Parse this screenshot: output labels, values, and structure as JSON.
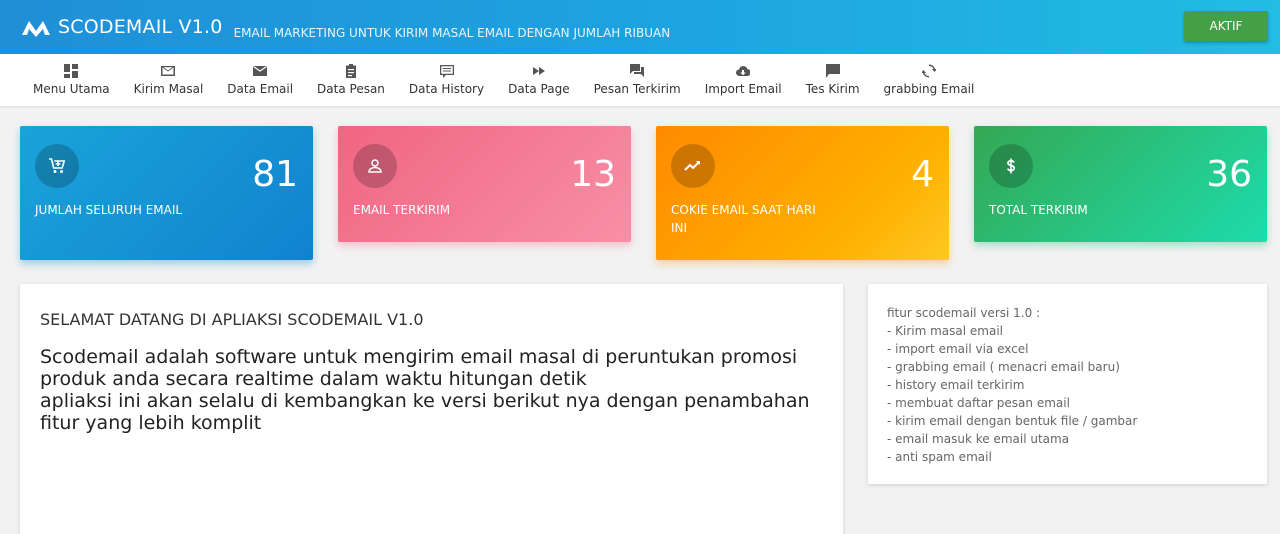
{
  "header": {
    "brand": "SCODEMAIL V1.0",
    "tagline": "EMAIL MARKETING UNTUK KIRIM MASAL EMAIL DENGAN JUMLAH RIBUAN",
    "status_button": "AKTIF",
    "colors": {
      "bar_start": "#1f8fd8",
      "bar_end": "#21bde3",
      "status": "#43a047"
    }
  },
  "nav": [
    {
      "label": "Menu Utama",
      "icon": "dashboard-icon"
    },
    {
      "label": "Kirim Masal",
      "icon": "envelope-outline-icon"
    },
    {
      "label": "Data Email",
      "icon": "envelope-icon"
    },
    {
      "label": "Data Pesan",
      "icon": "clipboard-icon"
    },
    {
      "label": "Data History",
      "icon": "message-list-icon"
    },
    {
      "label": "Data Page",
      "icon": "fast-forward-icon"
    },
    {
      "label": "Pesan Terkirim",
      "icon": "chat-icon"
    },
    {
      "label": "Import Email",
      "icon": "cloud-download-icon"
    },
    {
      "label": "Tes Kirim",
      "icon": "comment-icon"
    },
    {
      "label": "grabbing Email",
      "icon": "refresh-icon"
    }
  ],
  "stats": [
    {
      "value": "81",
      "label": "JUMLAH SELURUH EMAIL",
      "icon": "cart-add-icon",
      "color": "#1182cf"
    },
    {
      "value": "13",
      "label": "EMAIL TERKIRIM",
      "icon": "person-icon",
      "color": "#f06583"
    },
    {
      "value": "4",
      "label": "COKIE EMAIL SAAT HARI INI",
      "icon": "trending-icon",
      "color": "#ff9800"
    },
    {
      "value": "36",
      "label": "TOTAL TERKIRIM",
      "icon": "dollar-icon",
      "color": "#34a853"
    }
  ],
  "welcome": {
    "title": "SELAMAT DATANG DI APLIAKSI SCODEMAIL V1.0",
    "lines": [
      "Scodemail adalah software untuk mengirim email masal di peruntukan promosi produk anda secara realtime dalam waktu hitungan detik",
      "apliaksi ini akan selalu di kembangkan ke versi berikut nya dengan penambahan fitur yang lebih komplit"
    ]
  },
  "features": {
    "title": "fitur scodemail versi 1.0 :",
    "items": [
      "- Kirim masal email",
      "- import email via excel",
      "- grabbing email ( menacri email baru)",
      "- history email terkirim",
      "- membuat daftar pesan email",
      "- kirim email dengan bentuk file / gambar",
      "- email masuk ke email utama",
      "- anti spam email"
    ]
  }
}
